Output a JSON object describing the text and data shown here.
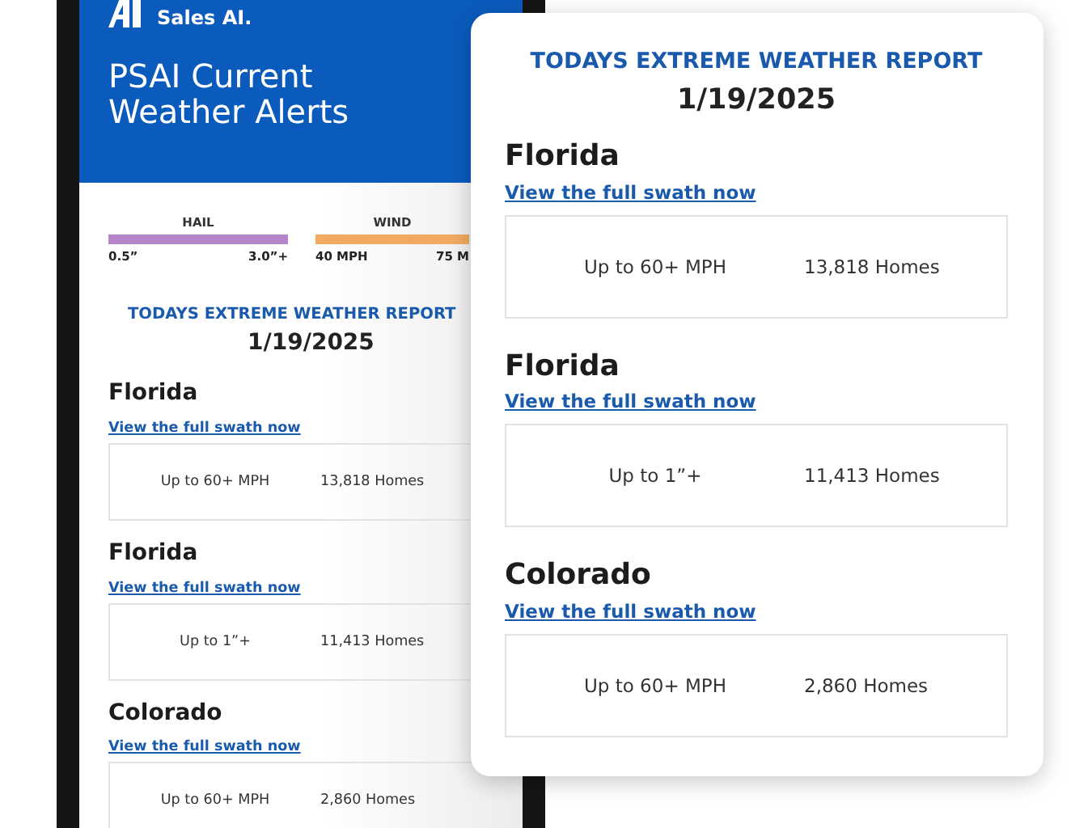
{
  "phone": {
    "logo": "Sales AI.",
    "title": "PSAI Current Weather Alerts",
    "legend": [
      {
        "label": "HAIL",
        "color": "#b585c9",
        "min": "0.5”",
        "max": "3.0”+"
      },
      {
        "label": "WIND",
        "color": "#f2aa63",
        "min": "40 MPH",
        "max": "75 M"
      }
    ],
    "report_title": "TODAYS EXTREME WEATHER REPORT",
    "date": "1/19/2025",
    "alerts": [
      {
        "state": "Florida",
        "link": "View the full swath now",
        "severity": "Up to 60+ MPH",
        "homes": "13,818 Homes"
      },
      {
        "state": "Florida",
        "link": "View the full swath now",
        "severity": "Up to 1”+",
        "homes": "11,413 Homes"
      },
      {
        "state": "Colorado",
        "link": "View the full swath now",
        "severity": "Up to 60+ MPH",
        "homes": "2,860 Homes"
      }
    ]
  },
  "card": {
    "report_title": "TODAYS EXTREME WEATHER REPORT",
    "date": "1/19/2025",
    "alerts": [
      {
        "state": "Florida",
        "link": "View the full swath now",
        "severity": "Up to 60+ MPH",
        "homes": "13,818 Homes"
      },
      {
        "state": "Florida",
        "link": "View the full swath now",
        "severity": "Up to 1”+",
        "homes": "11,413 Homes"
      },
      {
        "state": "Colorado",
        "link": "View the full swath now",
        "severity": "Up to 60+ MPH",
        "homes": "2,860 Homes"
      }
    ]
  }
}
